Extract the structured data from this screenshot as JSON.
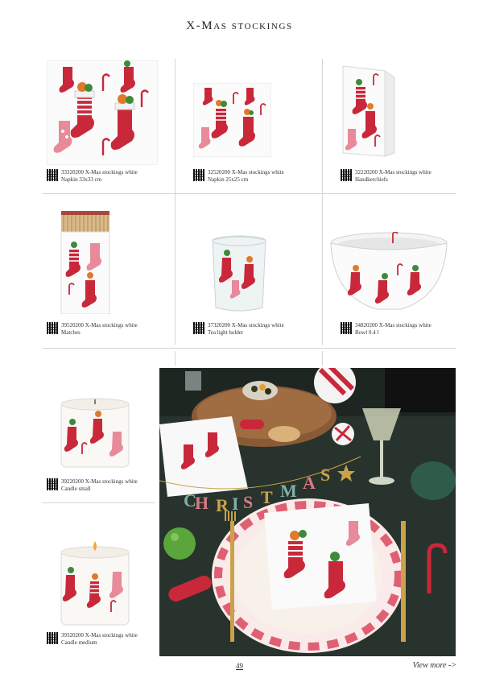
{
  "page": {
    "title": "X-Mas stockings",
    "page_number": "49",
    "view_more": "View more ->"
  },
  "products": [
    {
      "code": "33320200",
      "name": "X-Mas stockings white",
      "desc": "Napkin 33x33 cm"
    },
    {
      "code": "32520200",
      "name": "X-Mas stockings white",
      "desc": "Napkin 25x25 cm"
    },
    {
      "code": "32220200",
      "name": "X-Mas stockings white",
      "desc": "Handkerchiefs"
    },
    {
      "code": "39520200",
      "name": "X-Mas stockings white",
      "desc": "Matches"
    },
    {
      "code": "37320200",
      "name": "X-Mas stockings white",
      "desc": "Tea light holder"
    },
    {
      "code": "34820200",
      "name": "X-Mas stockings white",
      "desc": "Bowl 0.4 l"
    },
    {
      "code": "39220200",
      "name": "X-Mas stockings white",
      "desc": "Candle small"
    },
    {
      "code": "39320200",
      "name": "X-Mas stockings white",
      "desc": "Candle medium"
    }
  ],
  "scene": {
    "garland_letters": [
      "C",
      "H",
      "R",
      "I",
      "S",
      "T",
      "M",
      "A",
      "S"
    ]
  },
  "colors": {
    "stocking_red": "#c8283a",
    "stocking_pink": "#e88a9a",
    "holly_green": "#3f8a3a",
    "table_green": "#27332c",
    "gold": "#c9a24a"
  }
}
